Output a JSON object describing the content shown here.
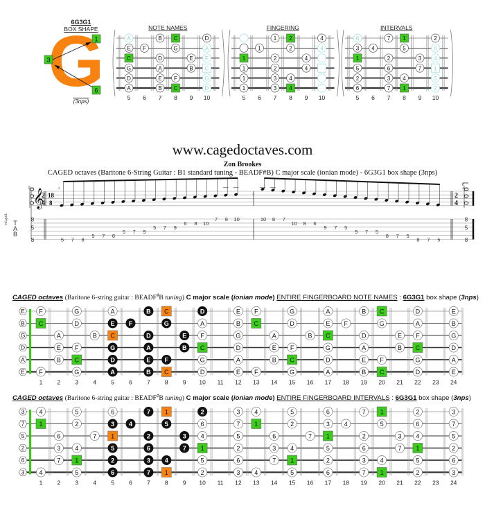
{
  "box_shape": {
    "code": "6G3G1",
    "label": "BOX SHAPE",
    "letter": "G",
    "letter_color": "#f7820f",
    "nps": "(3nps)",
    "root_markers": [
      "1",
      "3",
      "6"
    ]
  },
  "mini_diagrams": [
    {
      "title": "NOTE NAMES",
      "frets": [
        "5",
        "6",
        "7",
        "8",
        "9",
        "10"
      ],
      "strings": [
        [
          "A",
          "",
          "B",
          "C",
          "",
          "D"
        ],
        [
          "E",
          "F",
          "",
          "G",
          "",
          "A"
        ],
        [
          "C",
          "",
          "D",
          "",
          "E",
          "F"
        ],
        [
          "G",
          "",
          "A",
          "",
          "B",
          "C"
        ],
        [
          "D",
          "",
          "E",
          "F",
          "",
          "G"
        ],
        [
          "A",
          "",
          "B",
          "C",
          "",
          "D"
        ]
      ]
    },
    {
      "title": "FINGERING",
      "frets": [
        "5",
        "6",
        "7",
        "8",
        "9",
        "10"
      ],
      "strings": [
        [
          "",
          "",
          "1",
          "2",
          "",
          "4"
        ],
        [
          "",
          "1",
          "",
          "2",
          "",
          "4"
        ],
        [
          "1",
          "",
          "2",
          "",
          "4",
          ""
        ],
        [
          "1",
          "",
          "2",
          "",
          "4",
          ""
        ],
        [
          "1",
          "",
          "3",
          "4",
          "",
          ""
        ],
        [
          "1",
          "",
          "3",
          "4",
          "",
          ""
        ]
      ]
    },
    {
      "title": "INTERVALS",
      "frets": [
        "5",
        "6",
        "7",
        "8",
        "9",
        "10"
      ],
      "strings": [
        [
          "6",
          "",
          "7",
          "1",
          "",
          "2"
        ],
        [
          "3",
          "4",
          "",
          "5",
          "",
          "6"
        ],
        [
          "1",
          "",
          "2",
          "",
          "3",
          "4"
        ],
        [
          "5",
          "",
          "6",
          "",
          "7",
          "1"
        ],
        [
          "2",
          "",
          "3",
          "4",
          "",
          "5"
        ],
        [
          "6",
          "",
          "7",
          "1",
          "",
          "2"
        ]
      ]
    }
  ],
  "header": {
    "site": "www.cagedoctaves.com",
    "author": "Zon Brookes",
    "subtitle": "CAGED octaves (Baritone 6-String Guitar : B1 standard tuning - BEADF#B) C major scale (ionian mode) - 6G3G1 box shape (3nps)"
  },
  "notation": {
    "instrument": "ed.guit.",
    "time_sig_start": [
      "2",
      "4"
    ],
    "time_sig_mid": [
      "18",
      "8"
    ],
    "time_sig_end": [
      "2",
      "4"
    ],
    "tab_label": [
      "T",
      "A",
      "B"
    ],
    "measure_numbers": [
      "1",
      "2",
      "3",
      "4"
    ],
    "chord_tab": [
      "8",
      "5",
      "8"
    ],
    "ascending_tab": [
      {
        "s": 6,
        "f": "5"
      },
      {
        "s": 6,
        "f": "7"
      },
      {
        "s": 6,
        "f": "8"
      },
      {
        "s": 5,
        "f": "5"
      },
      {
        "s": 5,
        "f": "7"
      },
      {
        "s": 5,
        "f": "8"
      },
      {
        "s": 4,
        "f": "5"
      },
      {
        "s": 4,
        "f": "7"
      },
      {
        "s": 4,
        "f": "9"
      },
      {
        "s": 3,
        "f": "5"
      },
      {
        "s": 3,
        "f": "7"
      },
      {
        "s": 3,
        "f": "9"
      },
      {
        "s": 2,
        "f": "6"
      },
      {
        "s": 2,
        "f": "8"
      },
      {
        "s": 2,
        "f": "10"
      },
      {
        "s": 1,
        "f": "7"
      },
      {
        "s": 1,
        "f": "8"
      },
      {
        "s": 1,
        "f": "10"
      }
    ],
    "descending_tab": [
      {
        "s": 1,
        "f": "10"
      },
      {
        "s": 1,
        "f": "8"
      },
      {
        "s": 1,
        "f": "7"
      },
      {
        "s": 2,
        "f": "10"
      },
      {
        "s": 2,
        "f": "8"
      },
      {
        "s": 2,
        "f": "6"
      },
      {
        "s": 3,
        "f": "9"
      },
      {
        "s": 3,
        "f": "7"
      },
      {
        "s": 3,
        "f": "5"
      },
      {
        "s": 4,
        "f": "9"
      },
      {
        "s": 4,
        "f": "7"
      },
      {
        "s": 4,
        "f": "5"
      },
      {
        "s": 5,
        "f": "8"
      },
      {
        "s": 5,
        "f": "7"
      },
      {
        "s": 5,
        "f": "5"
      },
      {
        "s": 6,
        "f": "8"
      },
      {
        "s": 6,
        "f": "7"
      },
      {
        "s": 6,
        "f": "5"
      }
    ]
  },
  "fingerboard_notes": {
    "caption": {
      "caged": "CAGED octaves",
      "guitar_pre": "(Baritone 6-string guitar : BEADF",
      "sharp": "♯",
      "guitar_post": "B ",
      "tuning": "tuning",
      "close": ")",
      "scale": "C major scale",
      "mode_open": "(",
      "mode": "ionian mode",
      "mode_close": ")",
      "section": "ENTIRE FINGERBOARD NOTE NAMES",
      "colon": " : ",
      "shape": "6G3G1",
      "shape_label": " box shape (",
      "nps": "3nps",
      "end": ")"
    },
    "open": [
      "E",
      "B",
      "G",
      "D",
      "A",
      "E"
    ],
    "strings": [
      {
        "1": "F",
        "3": "G",
        "5": "A",
        "7": "B",
        "8": "C",
        "10": "D",
        "12": "E",
        "13": "F",
        "15": "G",
        "17": "A",
        "19": "B",
        "20": "C",
        "22": "D",
        "24": "E"
      },
      {
        "1": "C",
        "3": "D",
        "5": "E",
        "6": "F",
        "8": "G",
        "10": "A",
        "12": "B",
        "13": "C",
        "15": "D",
        "17": "E",
        "18": "F",
        "20": "G",
        "22": "A",
        "24": "B"
      },
      {
        "2": "A",
        "4": "B",
        "5": "C",
        "7": "D",
        "9": "E",
        "10": "F",
        "12": "G",
        "14": "A",
        "16": "B",
        "17": "C",
        "19": "D",
        "21": "E",
        "22": "F",
        "24": "G"
      },
      {
        "2": "E",
        "3": "F",
        "5": "G",
        "7": "A",
        "9": "B",
        "10": "C",
        "12": "D",
        "14": "E",
        "15": "F",
        "17": "G",
        "19": "A",
        "21": "B",
        "22": "C",
        "24": "D"
      },
      {
        "2": "B",
        "3": "C",
        "5": "D",
        "7": "E",
        "8": "F",
        "10": "G",
        "12": "A",
        "14": "B",
        "15": "C",
        "17": "D",
        "19": "E",
        "20": "F",
        "22": "G",
        "24": "A"
      },
      {
        "1": "F",
        "3": "G",
        "5": "A",
        "7": "B",
        "8": "C",
        "10": "D",
        "12": "E",
        "13": "F",
        "15": "G",
        "17": "A",
        "19": "B",
        "20": "C",
        "22": "D",
        "24": "E"
      }
    ]
  },
  "fingerboard_intervals": {
    "caption": {
      "caged": "CAGED octaves",
      "guitar_pre": "(Baritone 6-string guitar : BEADF",
      "sharp": "♯",
      "guitar_post": "B ",
      "tuning": "tuning",
      "close": ")",
      "scale": "C major scale",
      "mode_open": "(",
      "mode": "ionian mode",
      "mode_close": ")",
      "section": "ENTIRE FINGERBOARD INTERVALS",
      "colon": " : ",
      "shape": "6G3G1",
      "shape_label": " box shape (",
      "nps": "3nps",
      "end": ")"
    },
    "open": [
      "3",
      "7",
      "5",
      "2",
      "6",
      "3"
    ],
    "strings": [
      {
        "1": "4",
        "3": "5",
        "5": "6",
        "7": "7",
        "8": "1",
        "10": "2",
        "12": "3",
        "13": "4",
        "15": "5",
        "17": "6",
        "19": "7",
        "20": "1",
        "22": "2",
        "24": "3"
      },
      {
        "1": "1",
        "3": "2",
        "5": "3",
        "6": "4",
        "8": "5",
        "10": "6",
        "12": "7",
        "13": "1",
        "15": "2",
        "17": "3",
        "18": "4",
        "20": "5",
        "22": "6",
        "24": "7"
      },
      {
        "2": "6",
        "4": "7",
        "5": "1",
        "7": "2",
        "9": "3",
        "10": "4",
        "12": "5",
        "14": "6",
        "16": "7",
        "17": "1",
        "19": "2",
        "21": "3",
        "22": "4",
        "24": "5"
      },
      {
        "2": "3",
        "3": "4",
        "5": "5",
        "7": "6",
        "9": "7",
        "10": "1",
        "12": "2",
        "14": "3",
        "15": "4",
        "17": "5",
        "19": "6",
        "21": "7",
        "22": "1",
        "24": "2"
      },
      {
        "2": "7",
        "3": "1",
        "5": "2",
        "7": "3",
        "8": "4",
        "10": "5",
        "12": "6",
        "14": "7",
        "15": "1",
        "17": "2",
        "19": "3",
        "20": "4",
        "22": "5",
        "24": "6"
      },
      {
        "1": "4",
        "3": "5",
        "5": "6",
        "7": "7",
        "8": "1",
        "10": "2",
        "12": "3",
        "13": "4",
        "15": "5",
        "17": "6",
        "19": "7",
        "20": "1",
        "22": "2",
        "24": "3"
      }
    ]
  },
  "fret_numbers": [
    "1",
    "2",
    "3",
    "4",
    "5",
    "6",
    "7",
    "8",
    "9",
    "10",
    "11",
    "12",
    "13",
    "14",
    "15",
    "16",
    "17",
    "18",
    "19",
    "20",
    "21",
    "22",
    "23",
    "24"
  ],
  "highlight": {
    "box_frets": [
      5,
      6,
      7,
      8,
      9,
      10
    ],
    "box_positions": [
      [
        7,
        8,
        10
      ],
      [
        5,
        6,
        8
      ],
      [
        5,
        7,
        9
      ],
      [
        5,
        7,
        9
      ],
      [
        5,
        7,
        8
      ],
      [
        5,
        7,
        8
      ]
    ],
    "box_roots": [
      [
        0,
        8
      ],
      [
        2,
        5
      ],
      [
        5,
        8
      ]
    ],
    "colors": {
      "root_green": "#3ccc1c",
      "box_root_orange": "#f7820f",
      "box_note_black": "#111111",
      "faded_cyan": "#9fe0e0",
      "nut_green": "#33cc11"
    }
  }
}
